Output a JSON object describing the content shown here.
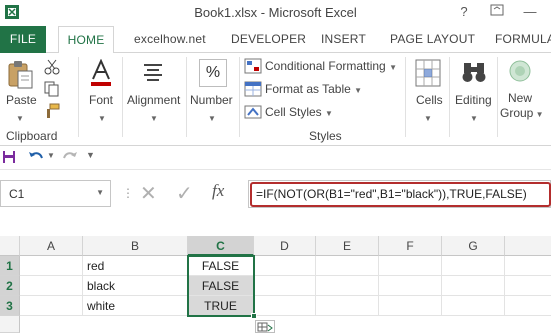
{
  "window": {
    "title": "Book1.xlsx - Microsoft Excel",
    "help": "?",
    "minimize": "—",
    "maximize": "❐"
  },
  "tabs": [
    "FILE",
    "HOME",
    "excelhow.net",
    "DEVELOPER",
    "INSERT",
    "PAGE LAYOUT",
    "FORMULA"
  ],
  "ribbon": {
    "clipboard": {
      "paste": "Paste",
      "group": "Clipboard"
    },
    "font": "Font",
    "alignment": "Alignment",
    "number": "Number",
    "number_icon": "%",
    "styles": {
      "conditional": "Conditional Formatting",
      "format_table": "Format as Table",
      "cell_styles": "Cell Styles",
      "group": "Styles"
    },
    "cells": "Cells",
    "editing": "Editing",
    "new_group": [
      "New",
      "Group"
    ]
  },
  "formula_bar": {
    "name_box": "C1",
    "fx": "fx",
    "cancel": "✕",
    "enter": "✓",
    "formula": "=IF(NOT(OR(B1=\"red\",B1=\"black\")),TRUE,FALSE)"
  },
  "grid": {
    "columns": [
      "A",
      "B",
      "C",
      "D",
      "E",
      "F",
      "G"
    ],
    "rows": [
      {
        "num": "1",
        "b": "red",
        "c": "FALSE"
      },
      {
        "num": "2",
        "b": "black",
        "c": "FALSE"
      },
      {
        "num": "3",
        "b": "white",
        "c": "TRUE"
      }
    ]
  },
  "colors": {
    "excel_green": "#217346",
    "highlight_red": "#b32d2d",
    "selection_gray": "#d9d9d9"
  }
}
